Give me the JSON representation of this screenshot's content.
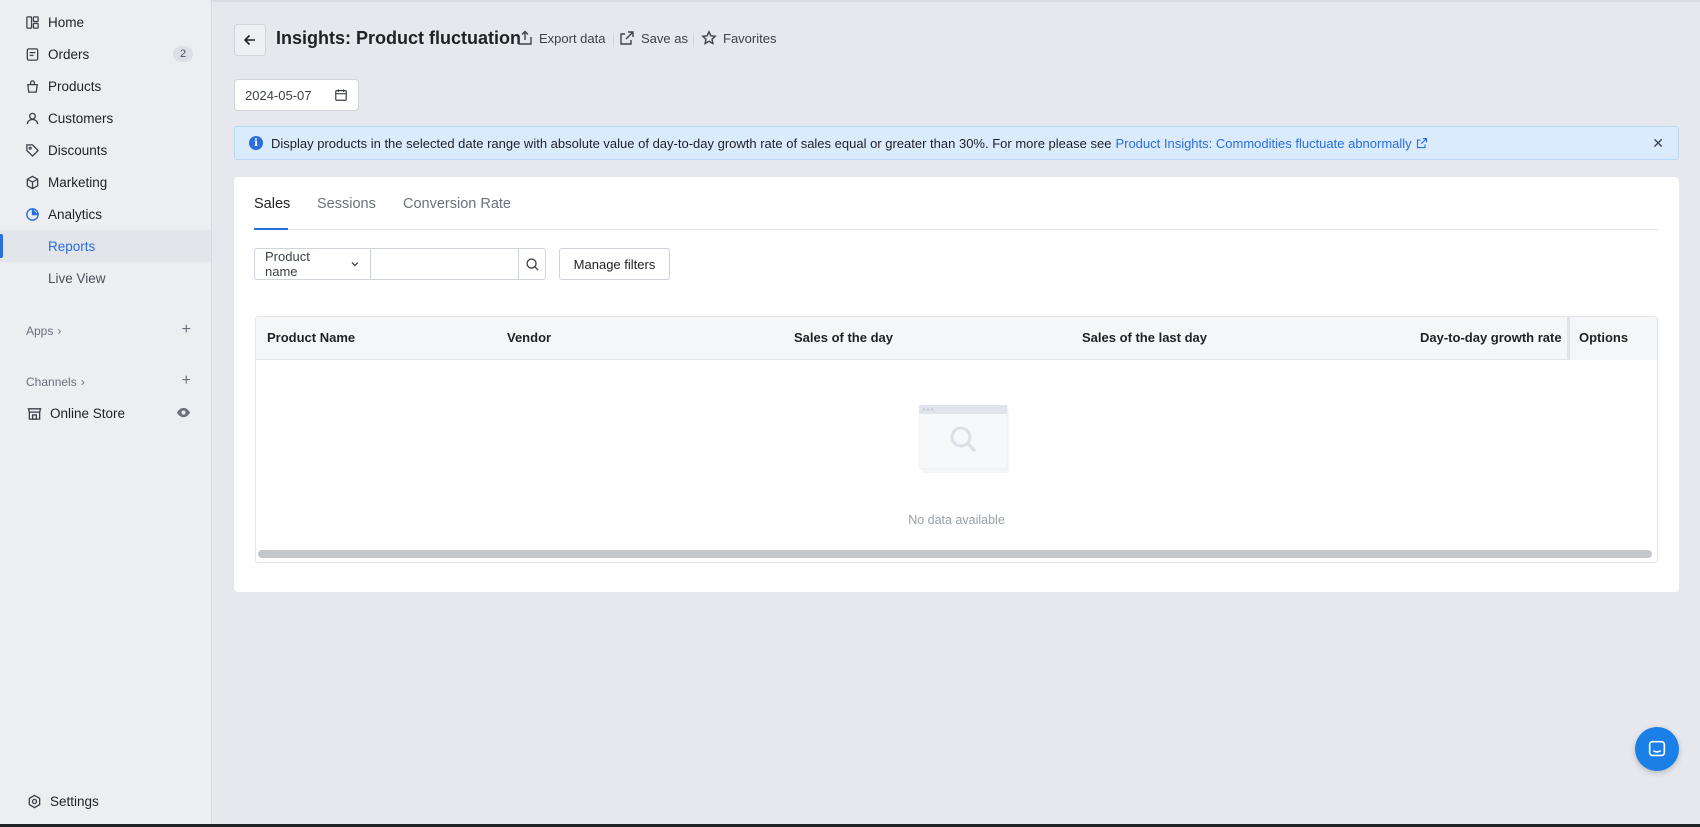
{
  "sidebar": {
    "items": [
      {
        "label": "Home",
        "icon": "home-icon"
      },
      {
        "label": "Orders",
        "icon": "orders-icon",
        "badge": "2"
      },
      {
        "label": "Products",
        "icon": "tag-bag-icon"
      },
      {
        "label": "Customers",
        "icon": "person-icon"
      },
      {
        "label": "Discounts",
        "icon": "discount-tag-icon"
      },
      {
        "label": "Marketing",
        "icon": "marketing-icon"
      },
      {
        "label": "Analytics",
        "icon": "analytics-pie-icon"
      },
      {
        "label": "Reports",
        "icon": ""
      },
      {
        "label": "Live View",
        "icon": ""
      }
    ],
    "apps_label": "Apps",
    "channels_label": "Channels",
    "online_store": "Online Store",
    "settings": "Settings"
  },
  "header": {
    "title": "Insights: Product fluctuation",
    "export": "Export data",
    "save_as": "Save as",
    "favorites": "Favorites"
  },
  "date_picker": {
    "value": "2024-05-07"
  },
  "banner": {
    "text": "Display products in the selected date range with absolute value of day-to-day growth rate of sales equal or greater than 30%. For more please see",
    "link": "Product Insights: Commodities fluctuate abnormally"
  },
  "tabs": [
    {
      "label": "Sales",
      "active": true
    },
    {
      "label": "Sessions",
      "active": false
    },
    {
      "label": "Conversion Rate",
      "active": false
    }
  ],
  "filters": {
    "field_select": "Product name",
    "search_placeholder": "",
    "manage_filters": "Manage filters"
  },
  "table": {
    "columns": [
      "Product Name",
      "Vendor",
      "Sales of the day",
      "Sales of the last day",
      "Day-to-day growth rate",
      "Options"
    ],
    "rows": [],
    "empty_text": "No data available"
  },
  "colors": {
    "accent": "#2a6ee0",
    "banner_bg": "#d9ebfd",
    "page_bg": "#e6e8ed"
  }
}
